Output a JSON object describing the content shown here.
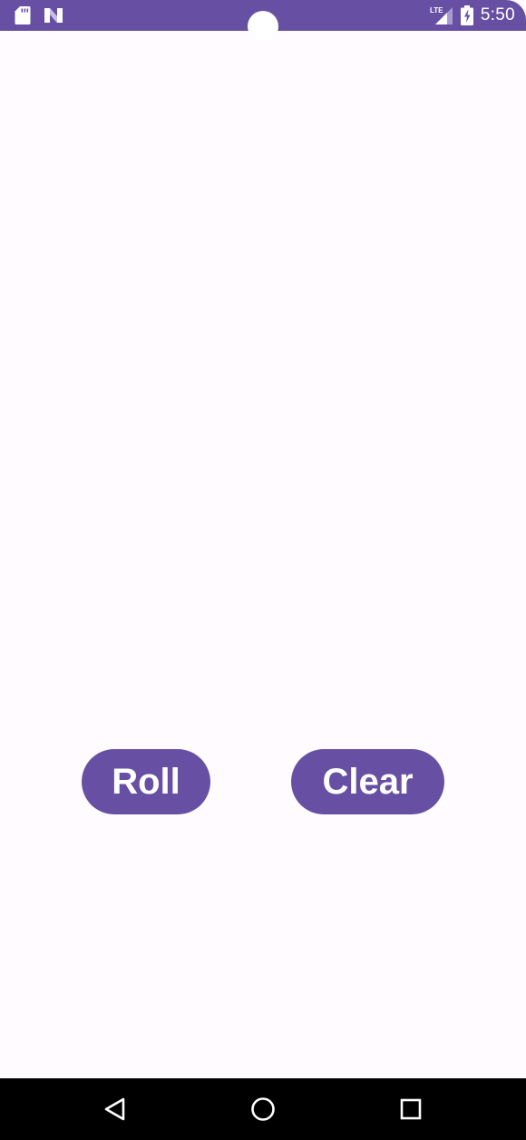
{
  "status_bar": {
    "time": "5:50",
    "network_label": "LTE",
    "icons": [
      "sd-card-icon",
      "n-logo-icon",
      "lte-signal-icon",
      "battery-charging-icon"
    ]
  },
  "main": {
    "roll_button_label": "Roll",
    "clear_button_label": "Clear"
  },
  "nav_bar": {
    "buttons": [
      "back-icon",
      "home-icon",
      "recents-icon"
    ]
  },
  "colors": {
    "primary": "#6750a4",
    "background": "#fffbfe",
    "on_primary": "#ffffff",
    "nav_background": "#000000"
  }
}
